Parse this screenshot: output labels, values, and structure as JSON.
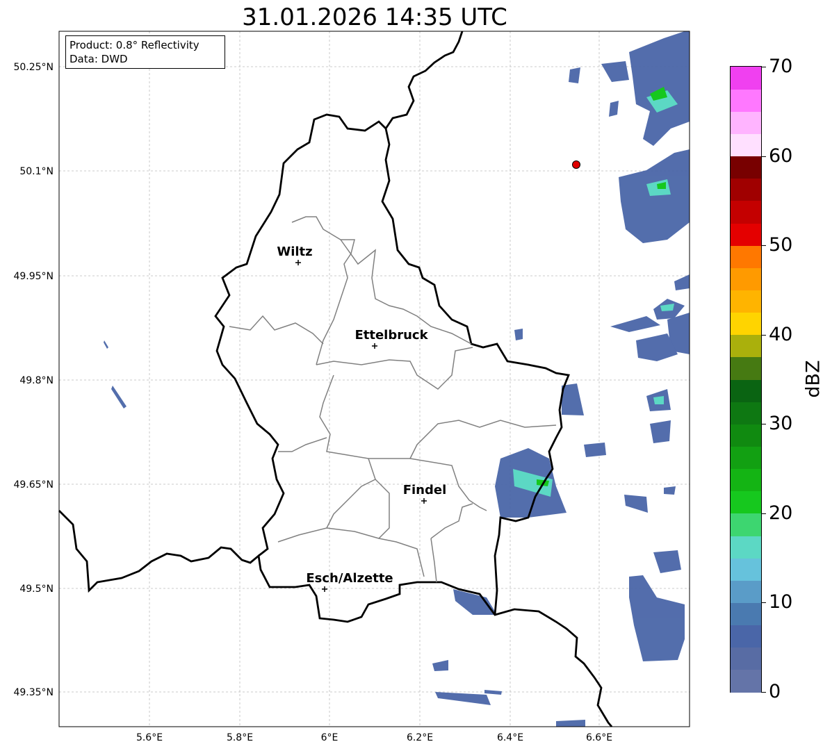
{
  "map": {
    "title": "31.01.2026 14:35 UTC",
    "info_box": {
      "product": "Product: 0.8° Reflectivity",
      "data": "Data: DWD"
    },
    "lat_labels": [
      "50.25°N",
      "50.1°N",
      "49.95°N",
      "49.8°N",
      "49.65°N",
      "49.5°N",
      "49.35°N"
    ],
    "lon_labels": [
      "5.6°E",
      "5.8°E",
      "6°E",
      "6.2°E",
      "6.4°E",
      "6.6°E"
    ],
    "towns": [
      {
        "name": "Wiltz"
      },
      {
        "name": "Ettelbruck"
      },
      {
        "name": "Findel"
      },
      {
        "name": "Esch/Alzette"
      }
    ],
    "marker": {
      "type": "red-dot",
      "color": "#e00000"
    },
    "grid": "dashed",
    "colors": {
      "border": "#000000",
      "internal_border": "#808080",
      "grid": "#bbbbbb"
    }
  },
  "colorbar": {
    "label": "dBZ",
    "min": 0,
    "max": 70,
    "tick_labels": [
      "0",
      "10",
      "20",
      "30",
      "40",
      "50",
      "60",
      "70"
    ],
    "colors": [
      "#6474a8",
      "#586ca4",
      "#4a66a8",
      "#4a7ab0",
      "#5a9cc8",
      "#66c2dc",
      "#5cd8c4",
      "#3dd670",
      "#16c81e",
      "#14b414",
      "#12a012",
      "#108a10",
      "#0e7812",
      "#0a6412",
      "#467a12",
      "#aab00c",
      "#ffd400",
      "#ffb400",
      "#ff9a00",
      "#ff7800",
      "#e40000",
      "#c40000",
      "#a00000",
      "#780000",
      "#ffe0ff",
      "#ffb4ff",
      "#ff78ff",
      "#f040f0"
    ]
  }
}
